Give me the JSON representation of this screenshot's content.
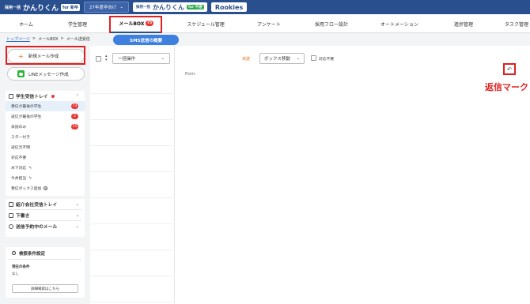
{
  "topbar": {
    "brand_small": "採用一括",
    "brand_big": "かんりくん",
    "brand_tag": "for 新卒",
    "year_select": "27年度卒向け",
    "pill_brand_small": "採用一括",
    "pill_brand_big": "かんりくん",
    "pill_brand_tag": "for 中途",
    "rookies": "Rookies",
    "colors": {
      "bar": "#2a4f8f",
      "accent": "#e02020"
    }
  },
  "mainnav": {
    "items": [
      {
        "label": "ホーム"
      },
      {
        "label": "学生管理"
      },
      {
        "label": "メールBOX",
        "badge": "75"
      },
      {
        "label": "スケジュール管理"
      },
      {
        "label": "アンケート"
      },
      {
        "label": "採用フロー設計"
      },
      {
        "label": "オートメーション"
      },
      {
        "label": "進捗管理"
      },
      {
        "label": "タスク管理"
      }
    ]
  },
  "breadcrumb": {
    "top": "トップページ",
    "sep": ">",
    "mailbox": "メールBOX",
    "current": "メール送受信"
  },
  "sms_button": "SMS送信の概要",
  "sidebar": {
    "new_mail": "新規メール作成",
    "line_message": "LINEメッセージ作成",
    "student_tray": {
      "title": "学生受信トレイ",
      "items": [
        {
          "label": "受信が最後の学生",
          "badge": "73"
        },
        {
          "label": "返信が最後の学生",
          "badge": "2"
        },
        {
          "label": "未読のみ",
          "badge": "75"
        },
        {
          "label": "スター付き"
        },
        {
          "label": "返信元不明"
        },
        {
          "label": "対応不要"
        },
        {
          "label": "木下対応"
        },
        {
          "label": "今井担当"
        },
        {
          "label": "受信ボックス追加"
        }
      ]
    },
    "agency_tray": "紹介会社受信トレイ",
    "drafts": "下書き",
    "scheduled": "送信予約中のメール",
    "search": {
      "title": "検索条件設定",
      "current_label": "現在の条件",
      "current_value": "なし",
      "advanced_button": "詳細検索はこちら"
    }
  },
  "list": {
    "bulk_action": "一括操作"
  },
  "detail": {
    "unread": "未読",
    "box_move": "ボックス移動",
    "no_action_label": "対応不要",
    "from_label": "From:"
  },
  "annotation": {
    "reply_mark": "返信マーク"
  }
}
